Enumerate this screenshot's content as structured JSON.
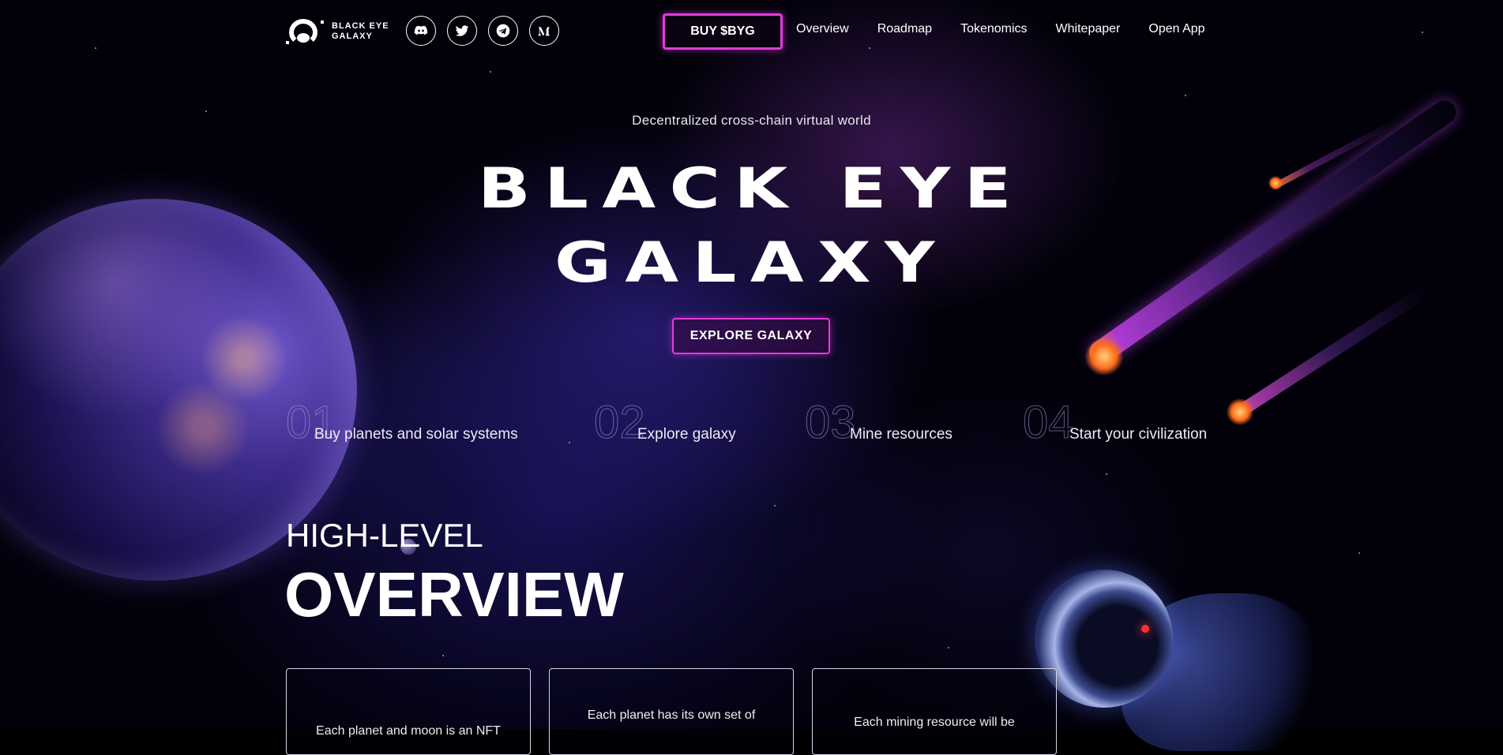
{
  "brand": {
    "name_line1": "BLACK EYE",
    "name_line2": "GALAXY"
  },
  "socials": [
    {
      "name": "discord-icon"
    },
    {
      "name": "twitter-icon"
    },
    {
      "name": "telegram-icon"
    },
    {
      "name": "medium-icon"
    }
  ],
  "header": {
    "buy_label": "BUY $BYG",
    "nav": [
      "Overview",
      "Roadmap",
      "Tokenomics",
      "Whitepaper",
      "Open App"
    ]
  },
  "hero": {
    "tagline": "Decentralized cross-chain virtual world",
    "title_line1": "BLACK EYE",
    "title_line2": "GALAXY",
    "cta_label": "EXPLORE GALAXY"
  },
  "steps": [
    {
      "num": "01",
      "label": "Buy planets and solar systems"
    },
    {
      "num": "02",
      "label": "Explore galaxy"
    },
    {
      "num": "03",
      "label": "Mine resources"
    },
    {
      "num": "04",
      "label": "Start your civilization"
    }
  ],
  "overview": {
    "subtitle": "HIGH-LEVEL",
    "title": "OVERVIEW",
    "cards": [
      "Each planet and moon is an NFT",
      "Each planet has its own set of",
      "Each mining resource will be"
    ]
  },
  "colors": {
    "accent": "#e23bd9",
    "background": "#02010a"
  }
}
